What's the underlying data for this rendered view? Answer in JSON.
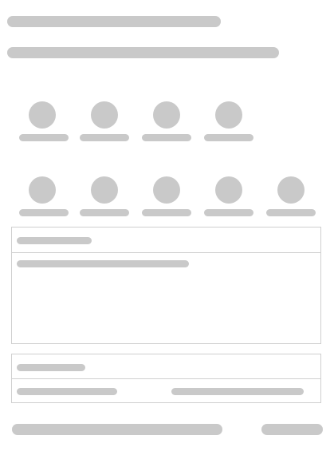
{
  "header": {
    "title": "",
    "subtitle": ""
  },
  "avatar_grid": {
    "row_1": [
      {
        "label": ""
      },
      {
        "label": ""
      },
      {
        "label": ""
      },
      {
        "label": ""
      }
    ],
    "row_2": [
      {
        "label": ""
      },
      {
        "label": ""
      },
      {
        "label": ""
      },
      {
        "label": ""
      },
      {
        "label": ""
      }
    ]
  },
  "panel_1": {
    "heading": "",
    "body_line": ""
  },
  "panel_2": {
    "heading": "",
    "left_value": "",
    "right_value": ""
  },
  "footer": {
    "primary_label": "",
    "secondary_label": ""
  },
  "colors": {
    "placeholder": "#c9c9c9",
    "border": "#cfcfcf",
    "background": "#ffffff"
  }
}
